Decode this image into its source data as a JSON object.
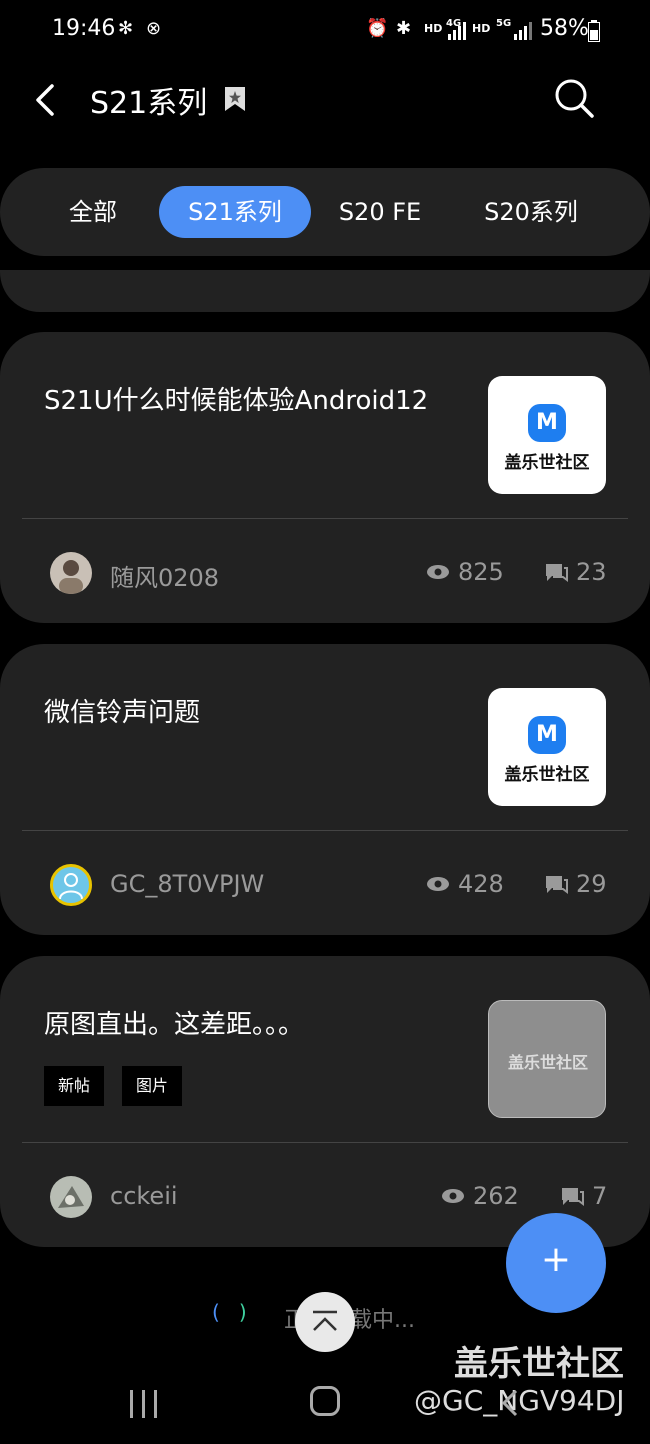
{
  "status_bar": {
    "time": "19:46",
    "network_labels": [
      "HD",
      "4G",
      "HD",
      "5G"
    ],
    "battery": "58%"
  },
  "header": {
    "title": "S21系列"
  },
  "tabs": [
    {
      "label": "全部",
      "active": false
    },
    {
      "label": "S21系列",
      "active": true
    },
    {
      "label": "S20 FE",
      "active": false
    },
    {
      "label": "S20系列",
      "active": false
    }
  ],
  "posts": [
    {
      "title": "S21U什么时候能体验Android12",
      "thumbnail_text": "盖乐世社区",
      "thumbnail_logo": "M",
      "author": "随风0208",
      "views": "825",
      "comments": "23",
      "tags": []
    },
    {
      "title": "微信铃声问题",
      "thumbnail_text": "盖乐世社区",
      "thumbnail_logo": "M",
      "author": "GC_8T0VPJW",
      "views": "428",
      "comments": "29",
      "tags": []
    },
    {
      "title": "原图直出。这差距。。。",
      "thumbnail_text": "盖乐世社区",
      "author": "cckeii",
      "views": "262",
      "comments": "7",
      "tags": [
        "新帖",
        "图片"
      ]
    }
  ],
  "fab": {
    "label": "+"
  },
  "loading": {
    "text": "正在加载中..."
  },
  "watermark": {
    "line1": "盖乐世社区",
    "line2": "@GC_NGV94DJ"
  },
  "colors": {
    "accent": "#4d8ff5",
    "card": "#222222",
    "background": "#000000"
  }
}
